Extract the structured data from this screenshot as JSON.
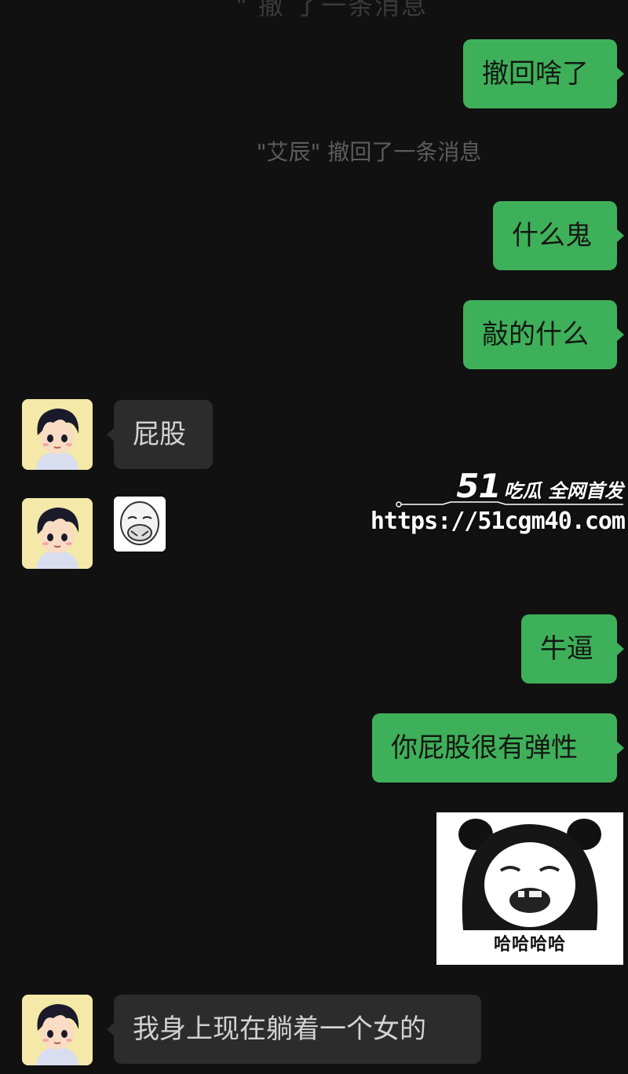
{
  "chat": {
    "top_cut_text": "\" 撤 了一条消息",
    "system_notice": "\"艾辰\" 撤回了一条消息",
    "messages": [
      {
        "side": "right",
        "text": "撤回啥了"
      },
      {
        "side": "right",
        "text": "什么鬼"
      },
      {
        "side": "right",
        "text": "敲的什么"
      },
      {
        "side": "left",
        "text": "屁股"
      },
      {
        "side": "left",
        "sticker": "covering-mouth-face"
      },
      {
        "side": "right",
        "text": "牛逼"
      },
      {
        "side": "right",
        "text": "你屁股很有弹性"
      },
      {
        "side": "right",
        "sticker": "panda-laughing-meme",
        "caption": "哈哈哈哈"
      },
      {
        "side": "left",
        "text": "我身上现在躺着一个女的"
      }
    ]
  },
  "watermark": {
    "brand_number": "51",
    "brand_text": "吃瓜 全网首发",
    "url": "https://51cgm40.com"
  },
  "colors": {
    "background": "#111111",
    "outgoing_bubble": "#3fb05a",
    "incoming_bubble": "#2c2c2c",
    "system_text": "#5c5c5c"
  },
  "icons": {
    "avatar": "cartoon-boy-avatar",
    "small_sticker": "covering-mouth-face",
    "meme": "panda-face-meme"
  }
}
